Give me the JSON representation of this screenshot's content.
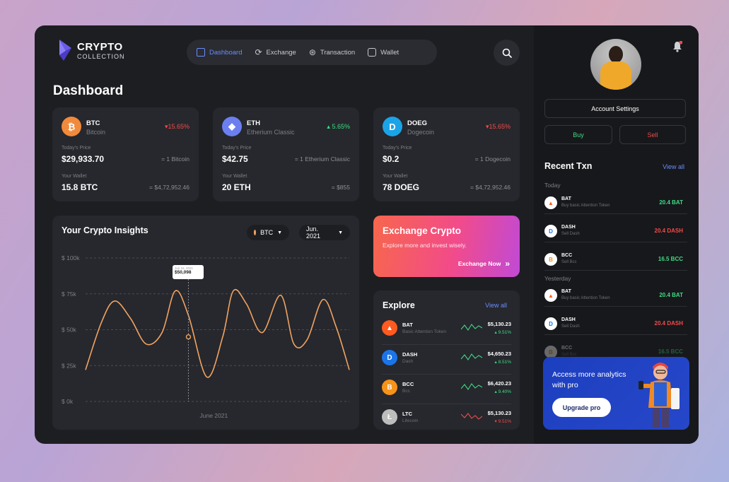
{
  "brand": {
    "title": "CRYPTO",
    "subtitle": "COLLECTION"
  },
  "nav": {
    "items": [
      {
        "label": "Dashboard",
        "active": true
      },
      {
        "label": "Exchange",
        "active": false
      },
      {
        "label": "Transaction",
        "active": false
      },
      {
        "label": "Wallet",
        "active": false
      }
    ]
  },
  "page_title": "Dashboard",
  "coins": [
    {
      "symbol": "BTC",
      "name": "Bitcoin",
      "change": "15.65%",
      "direction": "down",
      "price_label": "Today's Price",
      "price": "$29,933.70",
      "price_eq": "= 1 Bitcoin",
      "wallet_label": "Your Wallet",
      "wallet": "15.8 BTC",
      "wallet_eq": "= $4,72,952.46",
      "color": "#f08a3c",
      "glyph": "₿"
    },
    {
      "symbol": "ETH",
      "name": "Etherium Classic",
      "change": "5.65%",
      "direction": "up",
      "price_label": "Today's Price",
      "price": "$42.75",
      "price_eq": "= 1 Etherium Classic",
      "wallet_label": "Your Wallet",
      "wallet": "20 ETH",
      "wallet_eq": "= $855",
      "color": "#6b7ff0",
      "glyph": "◆"
    },
    {
      "symbol": "DOEG",
      "name": "Dogecoin",
      "change": "15.65%",
      "direction": "down",
      "price_label": "Today's Price",
      "price": "$0.2",
      "price_eq": "= 1 Dogecoin",
      "wallet_label": "Your Wallet",
      "wallet": "78 DOEG",
      "wallet_eq": "= $4,72,952.46",
      "color": "#1ba3e8",
      "glyph": "D"
    }
  ],
  "insights": {
    "title": "Your Crypto Insights",
    "coin_select": "BTC",
    "month_select": "Jun. 2021",
    "tooltip_label": "Jun 15, 2021",
    "tooltip_value": "$50,098"
  },
  "chart_data": {
    "type": "line",
    "title": "Your Crypto Insights",
    "xlabel": "June 2021",
    "ylabel": "",
    "ylim": [
      0,
      100000
    ],
    "yticks": [
      "$ 0k",
      "$ 25k",
      "$ 50k",
      "$ 75k",
      "$ 100k"
    ],
    "grid": true,
    "series": [
      {
        "name": "BTC",
        "color": "#f2a262",
        "x": [
          0,
          0.06,
          0.11,
          0.17,
          0.23,
          0.29,
          0.34,
          0.39,
          0.46,
          0.52,
          0.56,
          0.61,
          0.67,
          0.74,
          0.79,
          0.84,
          0.9,
          0.95,
          1.0
        ],
        "values": [
          22000,
          55000,
          70000,
          58000,
          40000,
          48000,
          77000,
          60000,
          17000,
          45000,
          77000,
          68000,
          48000,
          74000,
          40000,
          43000,
          71000,
          52000,
          22000
        ]
      }
    ]
  },
  "exchange": {
    "title": "Exchange Crypto",
    "subtitle": "Explore more and invest wisely.",
    "cta": "Exchange Now"
  },
  "explore": {
    "title": "Explore",
    "view_all": "View all",
    "items": [
      {
        "symbol": "BAT",
        "name": "Basic Attention Token",
        "price": "$5,130.23",
        "change": "9.51%",
        "direction": "up",
        "color": "#ff5a1f",
        "glyph": "▲"
      },
      {
        "symbol": "DASH",
        "name": "Dash",
        "price": "$4,650.23",
        "change": "8.51%",
        "direction": "up",
        "color": "#1c75e8",
        "glyph": "D"
      },
      {
        "symbol": "BCC",
        "name": "Bcc",
        "price": "$6,420.23",
        "change": "9.40%",
        "direction": "up",
        "color": "#f7931a",
        "glyph": "B"
      },
      {
        "symbol": "LTC",
        "name": "Litecoin",
        "price": "$5,130.23",
        "change": "9.51%",
        "direction": "down",
        "color": "#bdbdbd",
        "glyph": "Ł"
      }
    ]
  },
  "account": {
    "settings": "Account Settings",
    "buy": "Buy",
    "sell": "Sell"
  },
  "recent": {
    "title": "Recent Txn",
    "view_all": "View all",
    "today": "Today",
    "yesterday": "Yesterday",
    "today_items": [
      {
        "symbol": "BAT",
        "desc": "Buy basic Attention Token",
        "amount": "20.4 BAT",
        "direction": "up",
        "color": "#ff5a1f",
        "glyph": "▲"
      },
      {
        "symbol": "DASH",
        "desc": "Sell Dash",
        "amount": "20.4 DASH",
        "direction": "down",
        "color": "#1c75e8",
        "glyph": "D"
      },
      {
        "symbol": "BCC",
        "desc": "Sell Bcc",
        "amount": "16.5 BCC",
        "direction": "up",
        "color": "#f7931a",
        "glyph": "B"
      }
    ],
    "yesterday_items": [
      {
        "symbol": "BAT",
        "desc": "Buy basic Attention Token",
        "amount": "20.4 BAT",
        "direction": "up",
        "color": "#ff5a1f",
        "glyph": "▲"
      },
      {
        "symbol": "DASH",
        "desc": "Sell Dash",
        "amount": "20.4 DASH",
        "direction": "down",
        "color": "#1c75e8",
        "glyph": "D"
      },
      {
        "symbol": "BCC",
        "desc": "Sell Bcc",
        "amount": "16.5 BCC",
        "direction": "up",
        "color": "#f7931a",
        "glyph": "B"
      }
    ]
  },
  "upgrade": {
    "text": "Access more analytics with pro",
    "cta": "Upgrade pro"
  },
  "colors": {
    "accent": "#6b8cff",
    "green": "#3ddc84",
    "red": "#f24a4a",
    "panel": "#26282d",
    "background": "#1d1e22"
  }
}
